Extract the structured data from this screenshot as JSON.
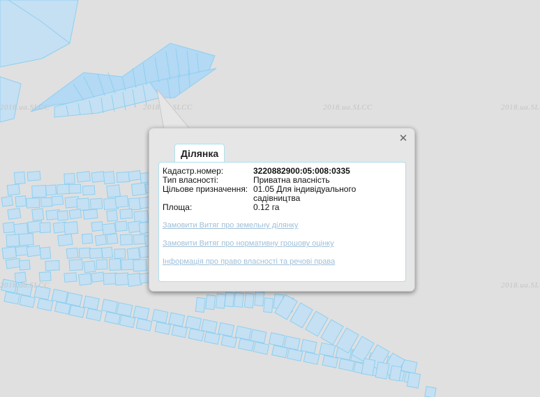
{
  "map": {
    "watermark_text": "2018.ua.SLCC",
    "colors": {
      "background": "#e0e0e0",
      "parcel_fill": "#c5e0f3",
      "parcel_stroke": "#8ecfef",
      "selected_fill": "#b3d9f5",
      "road": "#f0f0f0"
    }
  },
  "popup": {
    "tab_label": "Ділянка",
    "close_icon": "close-icon",
    "fields": [
      {
        "label": "Кадастр.номер:",
        "value": "3220882900:05:008:0335"
      },
      {
        "label": "Тип власності:",
        "value": "Приватна власність"
      },
      {
        "label": "Цільове призначення:",
        "value_line1": "01.05 Для індивідуального",
        "value_line2": "садівництва"
      },
      {
        "label": "Площа:",
        "value": "0.12 га"
      }
    ],
    "links": [
      "Замовити Витяг про земельну ділянку",
      "Замовити Витяг про нормативну грошову оцінку",
      "Інформація про право власності та речові права"
    ]
  }
}
